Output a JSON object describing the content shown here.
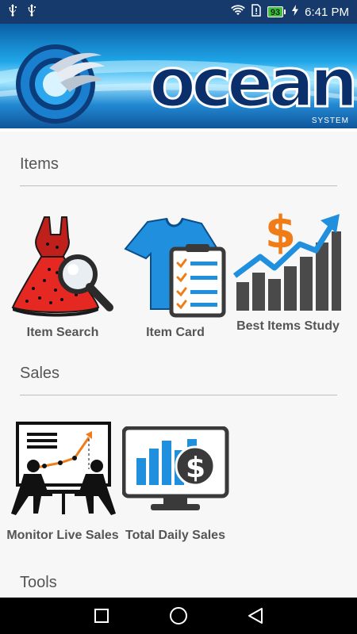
{
  "status_bar": {
    "left_icons": [
      "usb-icon",
      "usb-icon"
    ],
    "battery_level": "93",
    "time": "6:41 PM"
  },
  "banner": {
    "logo_text": "ocean",
    "system_text": "SYSTEM",
    "colors": {
      "dark_blue": "#0d4f93",
      "light_blue": "#1fa6e8",
      "white": "#ffffff"
    }
  },
  "sections": [
    {
      "title": "Items",
      "tiles": [
        {
          "label": "Item Search",
          "icon": "dress-search-icon"
        },
        {
          "label": "Item Card",
          "icon": "shirt-checklist-icon"
        },
        {
          "label": "Best Items Study",
          "icon": "dollar-growth-chart-icon"
        }
      ]
    },
    {
      "title": "Sales",
      "tiles": [
        {
          "label": "Monitor Live Sales",
          "icon": "meeting-chart-icon"
        },
        {
          "label": "Total Daily Sales",
          "icon": "monitor-dollar-chart-icon"
        }
      ]
    },
    {
      "title": "Tools",
      "tiles": []
    }
  ],
  "nav_bar": {
    "buttons": [
      "recent-apps-icon",
      "home-icon",
      "back-icon"
    ]
  }
}
